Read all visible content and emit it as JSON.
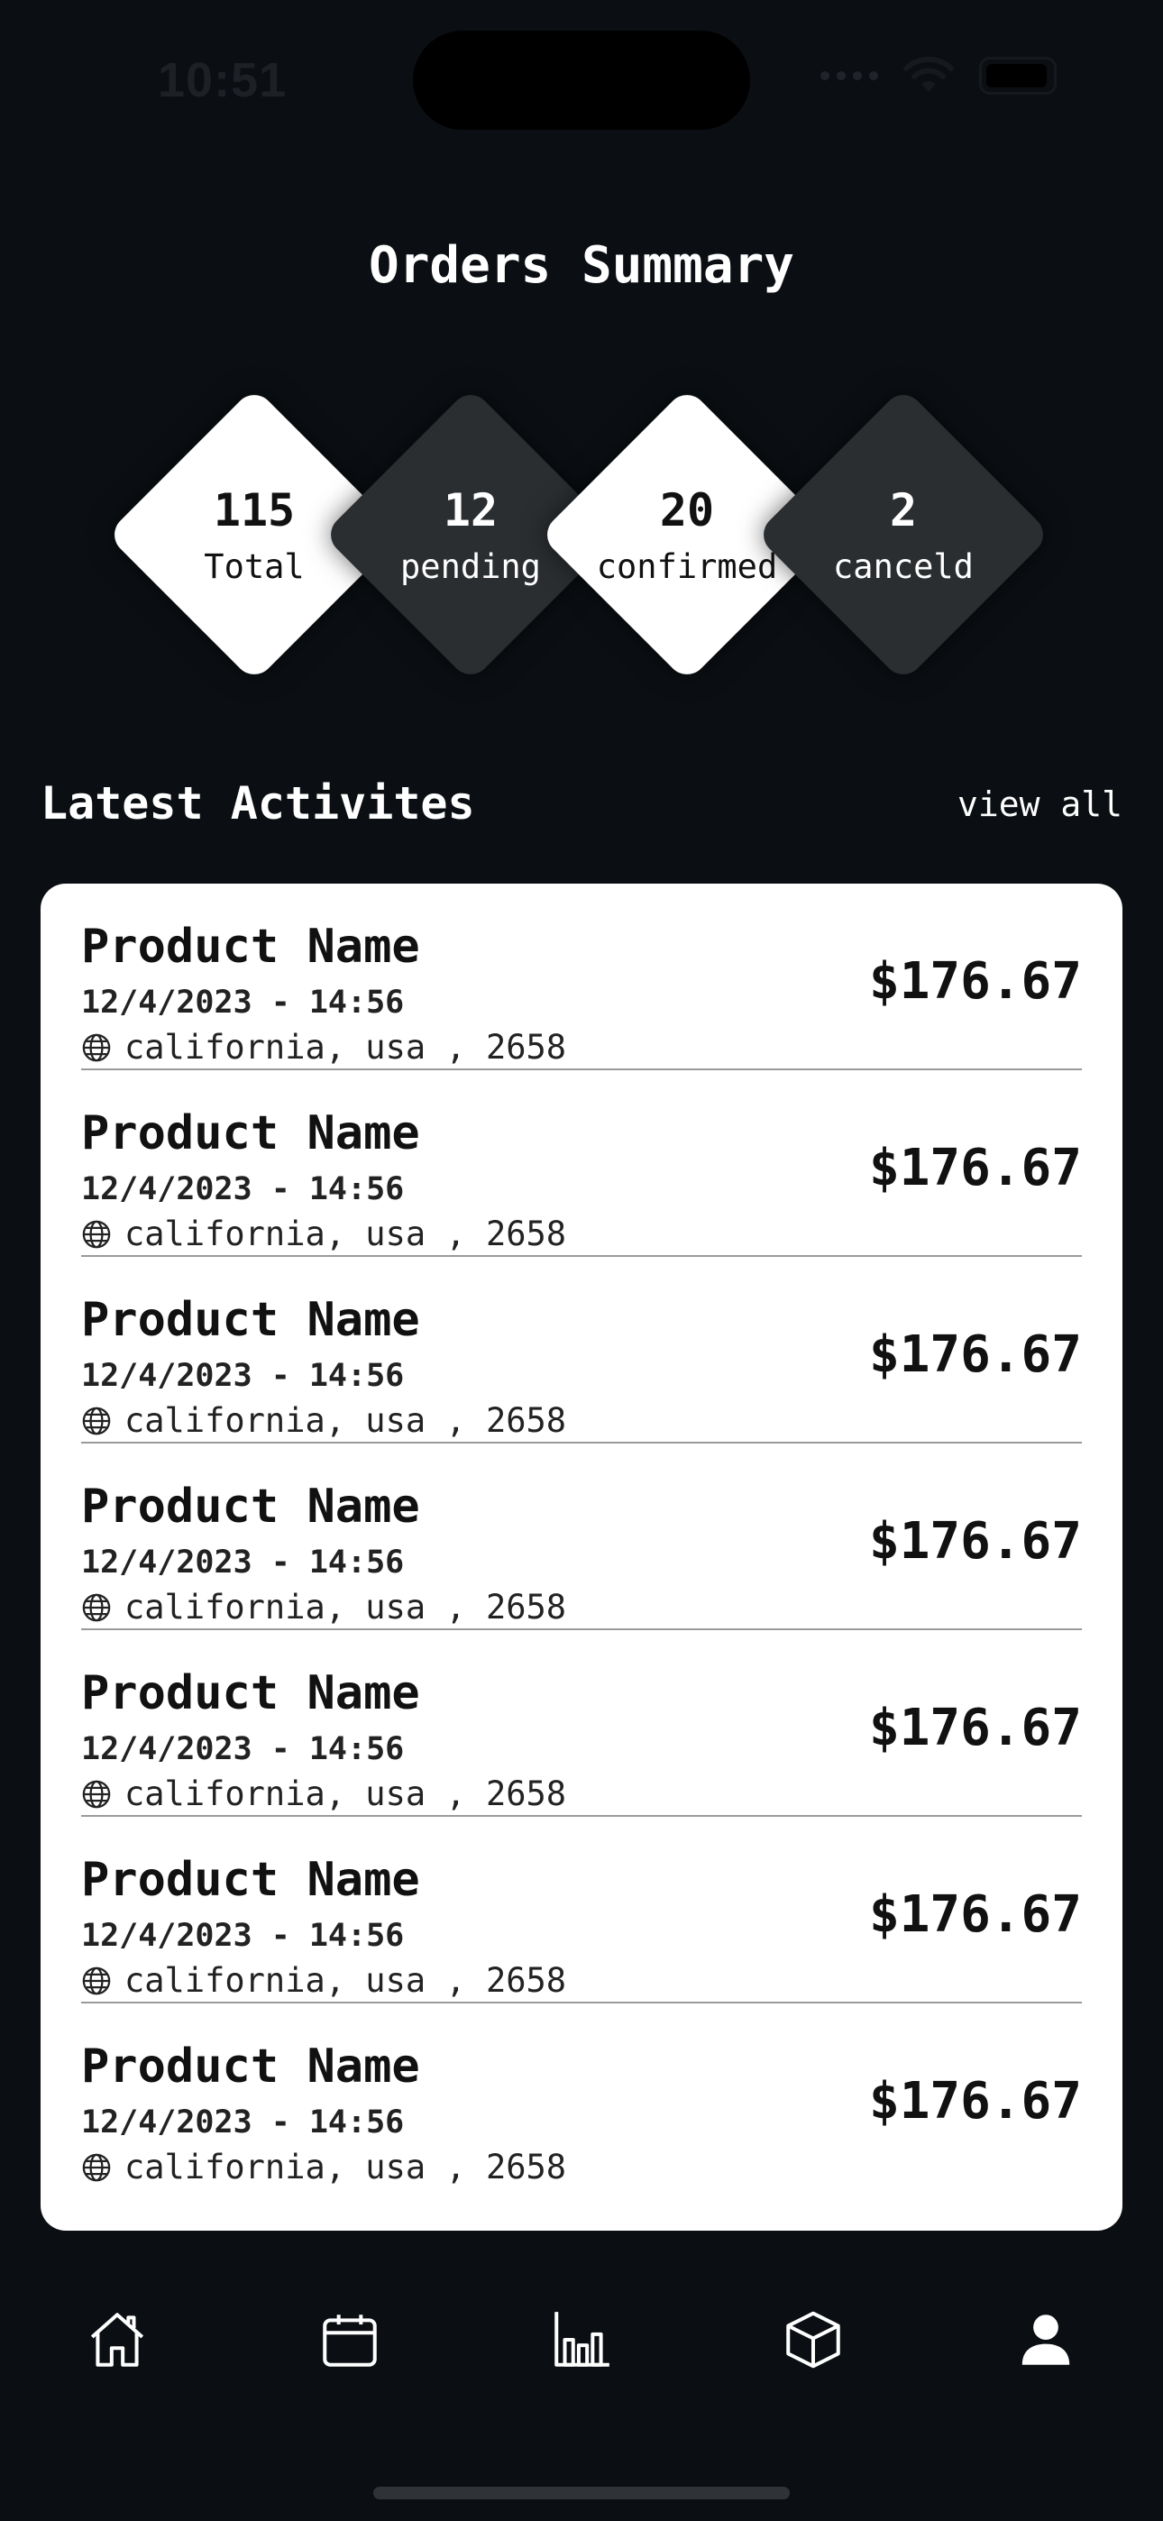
{
  "status": {
    "time": "10:51"
  },
  "title": "Orders Summary",
  "stats": [
    {
      "value": "115",
      "label": "Total",
      "style": "light"
    },
    {
      "value": "12",
      "label": "pending",
      "style": "dark"
    },
    {
      "value": "20",
      "label": "confirmed",
      "style": "light"
    },
    {
      "value": "2",
      "label": "canceld",
      "style": "dark"
    }
  ],
  "activities": {
    "title": "Latest Activites",
    "view_all": "view all",
    "items": [
      {
        "name": "Product Name",
        "date": "12/4/2023 - 14:56",
        "location": "california, usa , 2658",
        "price": "$176.67"
      },
      {
        "name": "Product Name",
        "date": "12/4/2023 - 14:56",
        "location": "california, usa , 2658",
        "price": "$176.67"
      },
      {
        "name": "Product Name",
        "date": "12/4/2023 - 14:56",
        "location": "california, usa , 2658",
        "price": "$176.67"
      },
      {
        "name": "Product Name",
        "date": "12/4/2023 - 14:56",
        "location": "california, usa , 2658",
        "price": "$176.67"
      },
      {
        "name": "Product Name",
        "date": "12/4/2023 - 14:56",
        "location": "california, usa , 2658",
        "price": "$176.67"
      },
      {
        "name": "Product Name",
        "date": "12/4/2023 - 14:56",
        "location": "california, usa , 2658",
        "price": "$176.67"
      },
      {
        "name": "Product Name",
        "date": "12/4/2023 - 14:56",
        "location": "california, usa , 2658",
        "price": "$176.67"
      }
    ]
  },
  "tabbar": {
    "items": [
      {
        "icon": "home-icon",
        "active": false
      },
      {
        "icon": "calendar-icon",
        "active": false
      },
      {
        "icon": "bar-chart-icon",
        "active": false
      },
      {
        "icon": "box-icon",
        "active": false
      },
      {
        "icon": "profile-icon",
        "active": true
      }
    ]
  }
}
